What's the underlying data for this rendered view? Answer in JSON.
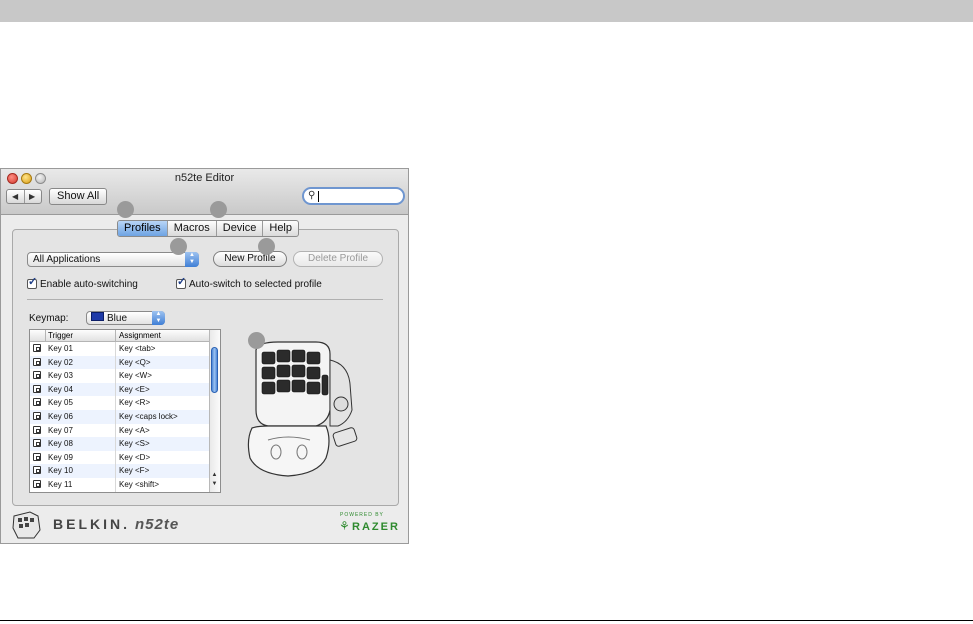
{
  "window": {
    "title": "n52te Editor"
  },
  "toolbar": {
    "show_all_label": "Show All",
    "back_glyph": "◀",
    "forward_glyph": "▶",
    "search_glyph": "⚲"
  },
  "tabs": [
    {
      "label": "Profiles",
      "active": true
    },
    {
      "label": "Macros",
      "active": false
    },
    {
      "label": "Device",
      "active": false
    },
    {
      "label": "Help",
      "active": false
    }
  ],
  "profile": {
    "selected_application": "All Applications",
    "new_profile_label": "New Profile",
    "delete_profile_label": "Delete Profile",
    "enable_auto_switching_label": "Enable auto-switching",
    "auto_switch_selected_label": "Auto-switch to selected profile"
  },
  "keymap": {
    "label": "Keymap:",
    "selected": "Blue",
    "selected_color": "#1e3aa8"
  },
  "table": {
    "headers": {
      "trigger": "Trigger",
      "assignment": "Assignment"
    },
    "rows": [
      {
        "trigger": "Key 01",
        "assignment": "Key <tab>"
      },
      {
        "trigger": "Key 02",
        "assignment": "Key <Q>"
      },
      {
        "trigger": "Key 03",
        "assignment": "Key <W>"
      },
      {
        "trigger": "Key 04",
        "assignment": "Key <E>"
      },
      {
        "trigger": "Key 05",
        "assignment": "Key <R>"
      },
      {
        "trigger": "Key 06",
        "assignment": "Key <caps lock>"
      },
      {
        "trigger": "Key 07",
        "assignment": "Key <A>"
      },
      {
        "trigger": "Key 08",
        "assignment": "Key <S>"
      },
      {
        "trigger": "Key 09",
        "assignment": "Key <D>"
      },
      {
        "trigger": "Key 10",
        "assignment": "Key <F>"
      },
      {
        "trigger": "Key 11",
        "assignment": "Key <shift>"
      }
    ]
  },
  "branding": {
    "belkin": "BELKIN.",
    "product": "n52te",
    "powered_by": "POWERED BY",
    "razer": "RAZER"
  }
}
